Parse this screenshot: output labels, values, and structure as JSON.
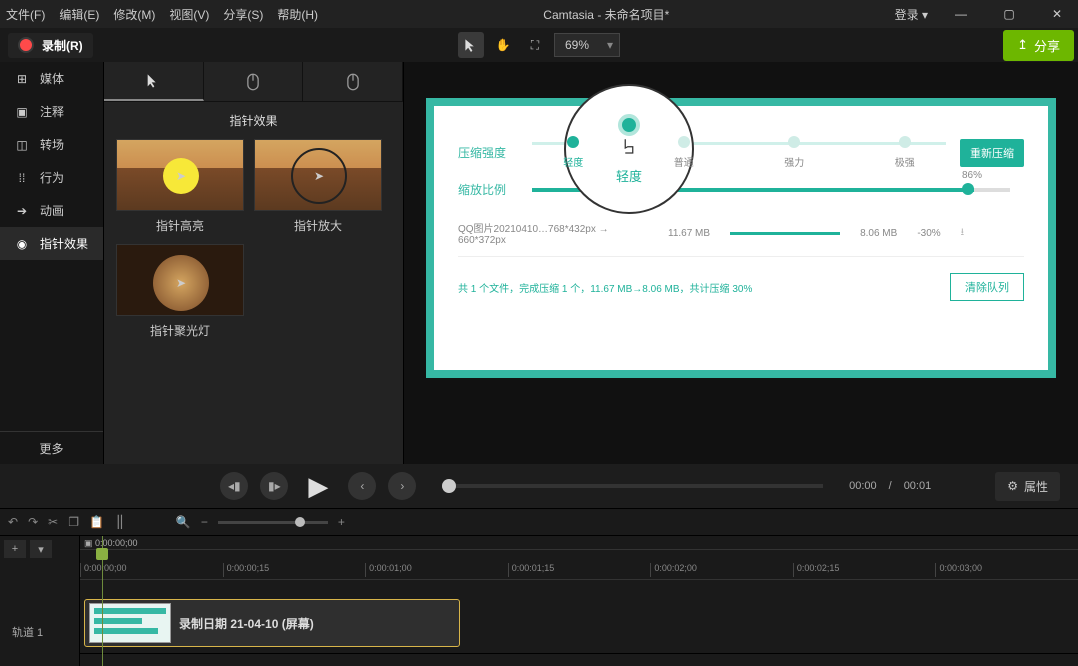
{
  "titlebar": {
    "menus": [
      "文件(F)",
      "编辑(E)",
      "修改(M)",
      "视图(V)",
      "分享(S)",
      "帮助(H)"
    ],
    "title": "Camtasia - 未命名项目*",
    "login": "登录 ▾",
    "win": {
      "min": "—",
      "max": "▢",
      "close": "✕"
    }
  },
  "toolbar": {
    "record": "录制(R)",
    "zoom": "69%",
    "share_label": "分享",
    "share_icon": "↥"
  },
  "sidebar": {
    "items": [
      {
        "icon": "⊞",
        "label": "媒体"
      },
      {
        "icon": "▣",
        "label": "注释"
      },
      {
        "icon": "◫",
        "label": "转场"
      },
      {
        "icon": "⁞⁞",
        "label": "行为"
      },
      {
        "icon": "➔",
        "label": "动画"
      },
      {
        "icon": "◉",
        "label": "指针效果"
      }
    ],
    "more": "更多"
  },
  "library": {
    "title": "指针效果",
    "thumbs": [
      {
        "label": "指针高亮"
      },
      {
        "label": "指针放大"
      },
      {
        "label": "指针聚光灯"
      }
    ]
  },
  "preview": {
    "row1_label": "压缩强度",
    "steps": [
      {
        "dot": "act",
        "lbl": "轻度",
        "la": "act"
      },
      {
        "dot": "",
        "lbl": "普通",
        "la": ""
      },
      {
        "dot": "",
        "lbl": "强力",
        "la": ""
      },
      {
        "dot": "",
        "lbl": "极强",
        "la": ""
      }
    ],
    "recompress": "重新压缩",
    "row2_label": "缩放比例",
    "slider_pct": "86%",
    "file": {
      "name": "QQ图片20210410…768*432px → 660*372px",
      "size_in": "11.67 MB",
      "size_out": "8.06 MB",
      "pct": "-30%",
      "dl": "⭳"
    },
    "summary": "共 1 个文件，完成压缩 1 个，11.67 MB→8.06 MB，共计压缩 30%",
    "clear": "清除队列",
    "mag_label": "轻度"
  },
  "playback": {
    "t_cur": "00:00",
    "t_sep": "/",
    "t_dur": "00:01",
    "props": "属性"
  },
  "timeline": {
    "start_tc": "0:00:00;00",
    "marks": [
      "0:00:00;00",
      "0:00:00;15",
      "0:00:01;00",
      "0:00:01;15",
      "0:00:02;00",
      "0:00:02;15",
      "0:00:03;00"
    ],
    "track_label": "轨道 1",
    "clip_label": "录制日期 21-04-10 (屏幕)"
  }
}
